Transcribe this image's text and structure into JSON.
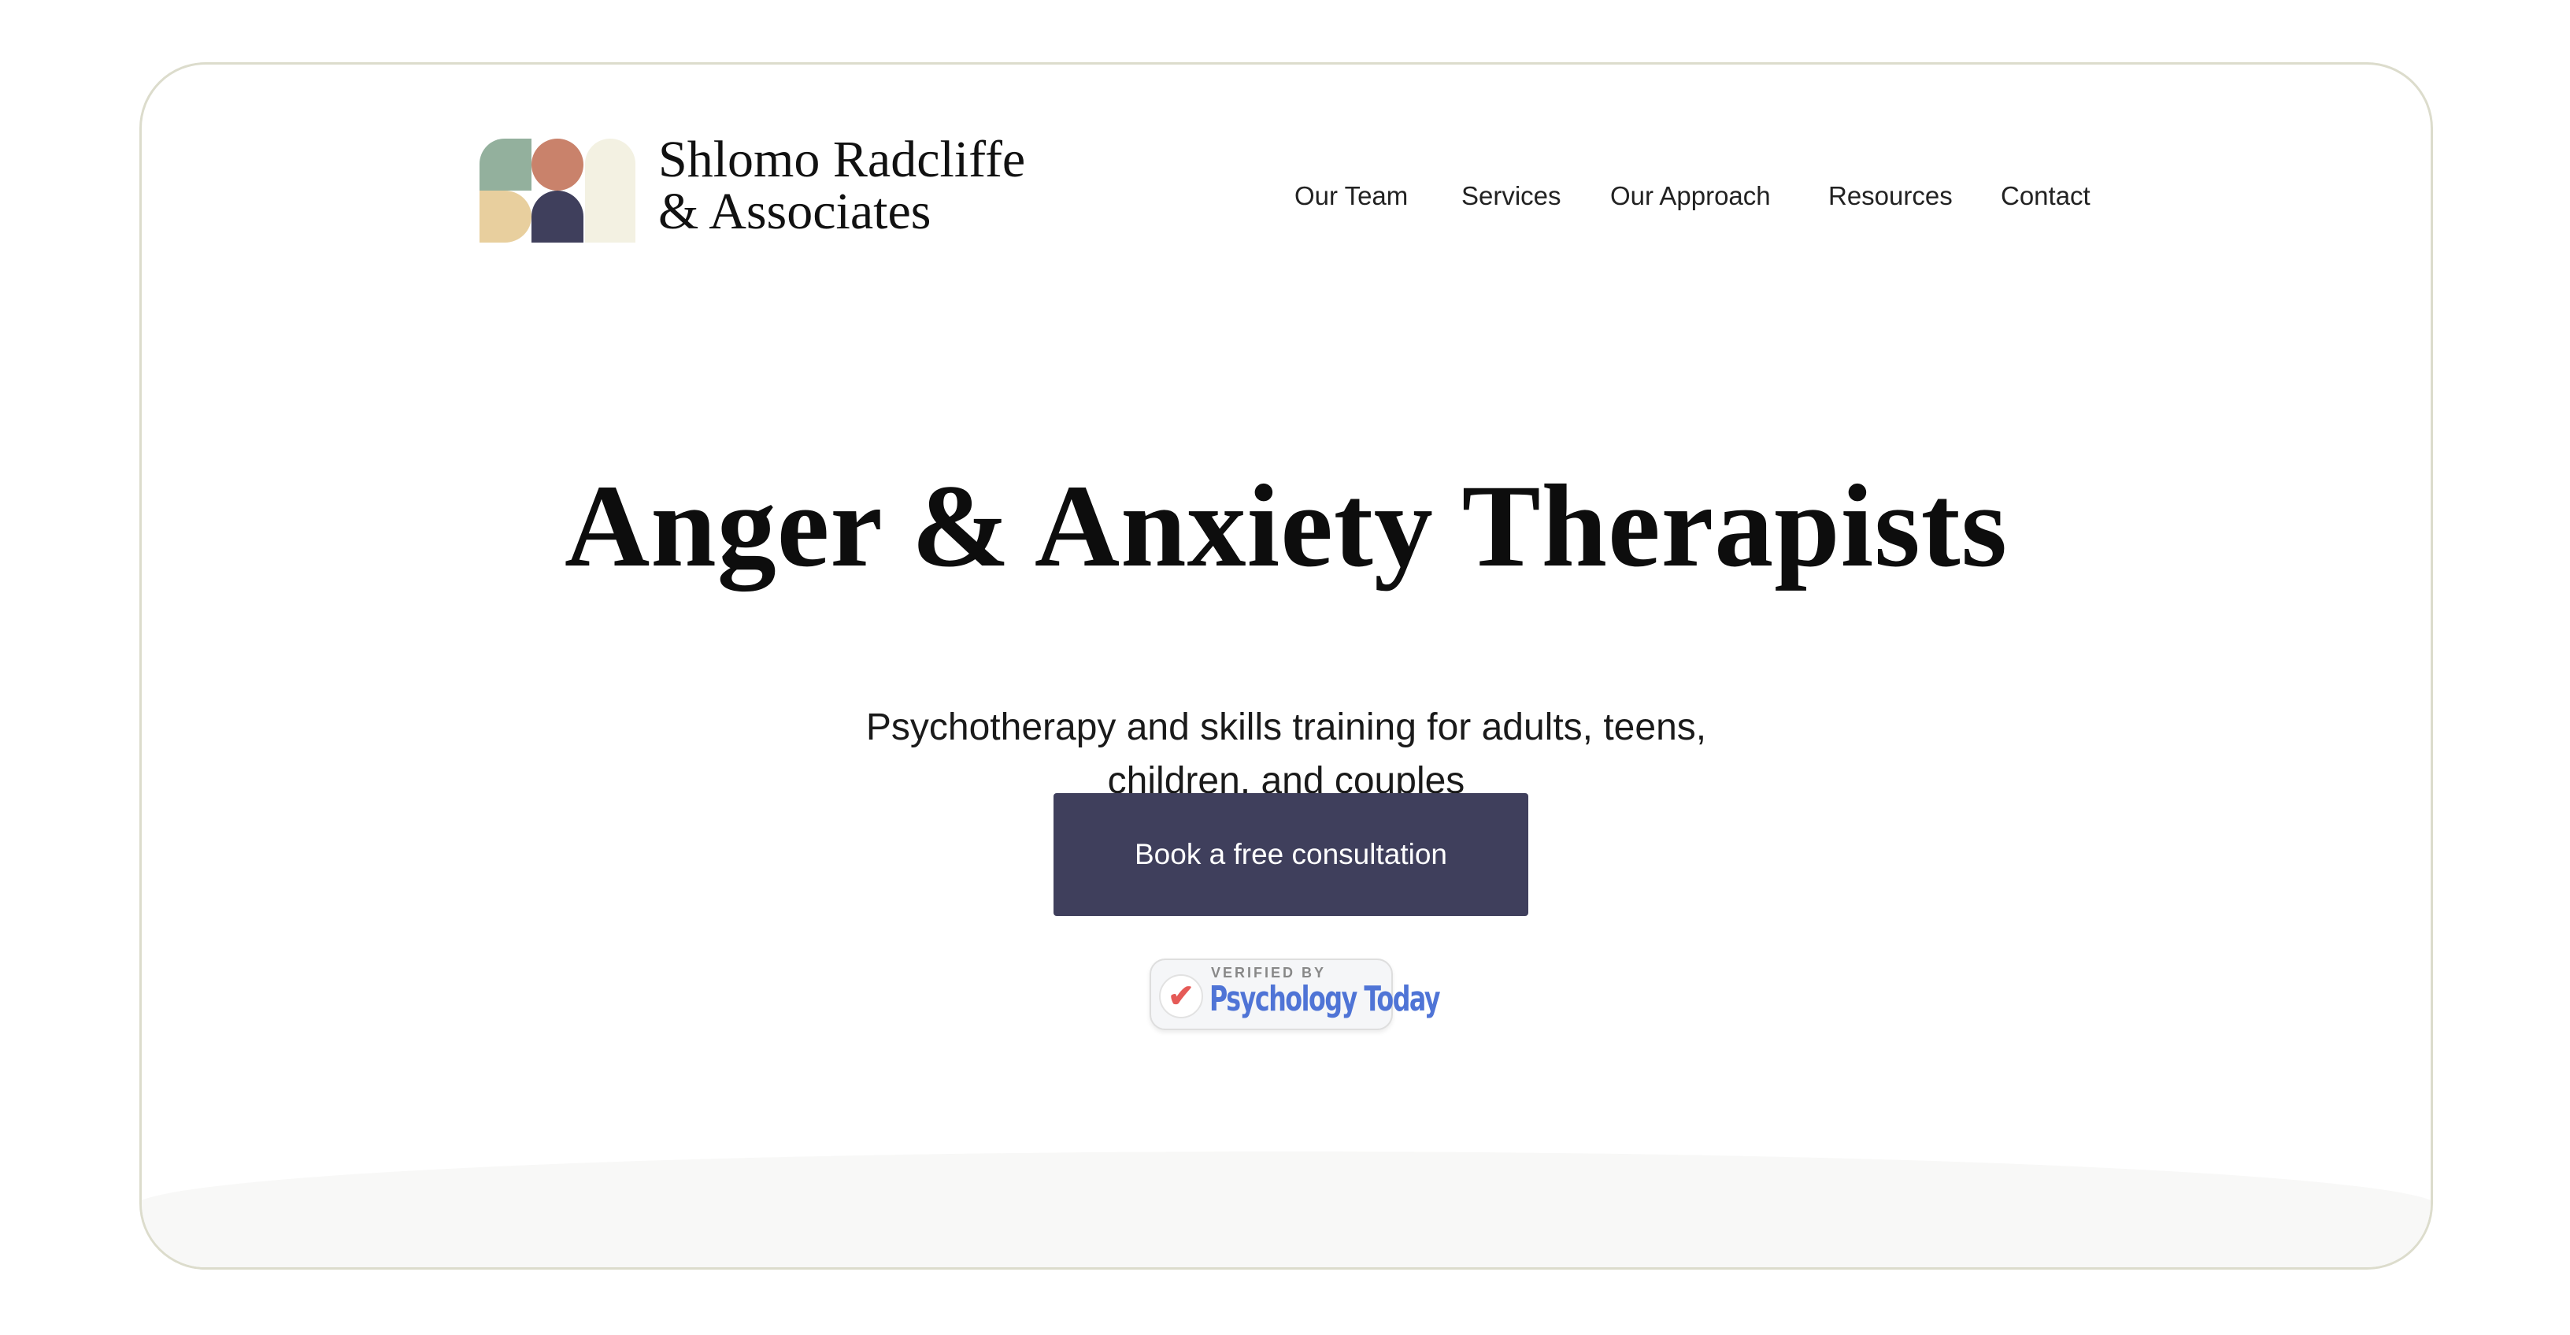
{
  "brand": {
    "line1": "Shlomo Radcliffe",
    "line2": "& Associates",
    "colors": [
      "#93b09d",
      "#c9826b",
      "#e8cf9e",
      "#3f3f5c",
      "#f3f1e2"
    ]
  },
  "nav": {
    "items": [
      "Our Team",
      "Services",
      "Our Approach",
      "Resources",
      "Contact"
    ]
  },
  "hero": {
    "title": "Anger & Anxiety Therapists",
    "subtitle_line1": "Psychotherapy and skills training for adults, teens,",
    "subtitle_line2": "children, and couples",
    "cta_label": "Book a free consultation",
    "cta_color": "#3f3f5c"
  },
  "badge": {
    "verified_by": "VERIFIED BY",
    "name": "Psychology Today",
    "icon": "check-icon"
  }
}
